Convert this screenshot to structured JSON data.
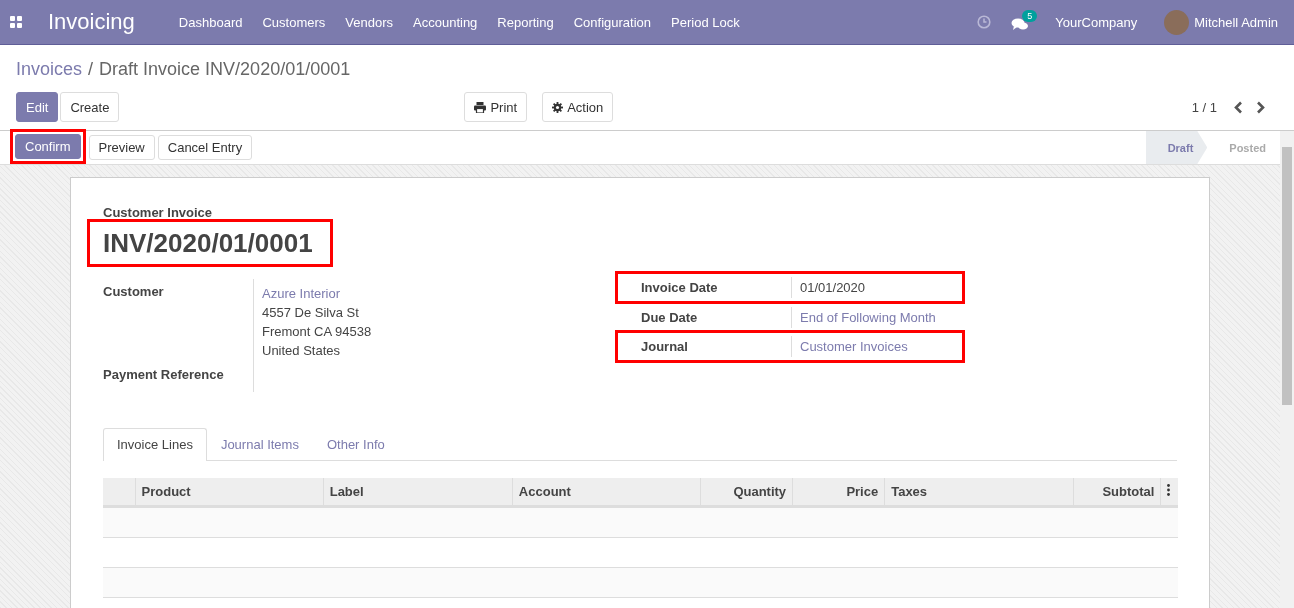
{
  "app": {
    "name": "Invoicing"
  },
  "menu": [
    "Dashboard",
    "Customers",
    "Vendors",
    "Accounting",
    "Reporting",
    "Configuration",
    "Period Lock"
  ],
  "systray": {
    "message_count": "5",
    "company": "YourCompany",
    "user": "Mitchell Admin"
  },
  "breadcrumb": {
    "parent": "Invoices",
    "separator": "/",
    "current": "Draft Invoice INV/2020/01/0001"
  },
  "control_buttons": [
    {
      "label": "Edit",
      "primary": true
    },
    {
      "label": "Create",
      "primary": false
    }
  ],
  "action_buttons": [
    {
      "label": "Print",
      "kind": "print"
    },
    {
      "label": "Action",
      "kind": "gear"
    }
  ],
  "pager": "1 / 1",
  "header_buttons": [
    {
      "label": "Confirm",
      "primary": true,
      "highlighted": true
    },
    {
      "label": "Preview",
      "primary": false,
      "highlighted": false
    },
    {
      "label": "Cancel Entry",
      "primary": false,
      "highlighted": false
    }
  ],
  "stages": [
    {
      "label": "Draft",
      "selected": true
    },
    {
      "label": "Posted",
      "selected": false
    }
  ],
  "sheet": {
    "type_label": "Customer Invoice",
    "number": "INV/2020/01/0001",
    "number_highlighted": true,
    "left_fields": [
      {
        "label": "Customer",
        "lines": [
          {
            "text": "Azure Interior",
            "link": true
          },
          {
            "text": "4557 De Silva St",
            "link": false
          },
          {
            "text": "Fremont CA 94538",
            "link": false
          },
          {
            "text": "United States",
            "link": false
          }
        ]
      },
      {
        "label": "Payment Reference"
      }
    ],
    "right_fields": [
      {
        "label": "Invoice Date",
        "value": "01/01/2020",
        "link": false,
        "highlighted": true
      },
      {
        "label": "Due Date",
        "value": "End of Following Month",
        "link": true,
        "highlighted": false
      },
      {
        "label": "Journal",
        "value": "Customer Invoices",
        "link": true,
        "highlighted": true
      }
    ],
    "tabs": [
      {
        "label": "Invoice Lines",
        "selected": true
      },
      {
        "label": "Journal Items",
        "selected": false
      },
      {
        "label": "Other Info",
        "selected": false
      }
    ],
    "table": {
      "columns": [
        "Product",
        "Label",
        "Account",
        "Quantity",
        "Price",
        "Taxes",
        "Subtotal"
      ]
    }
  }
}
